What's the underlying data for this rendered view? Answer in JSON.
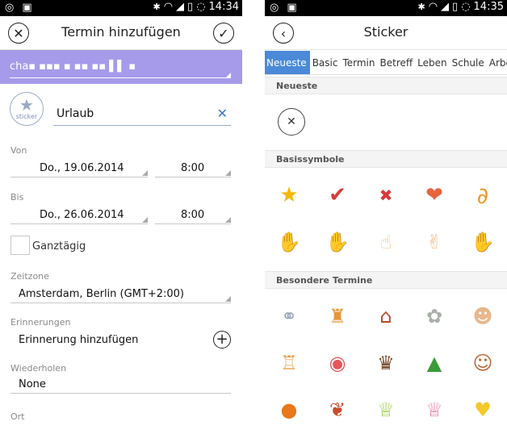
{
  "left": {
    "status_time": "14:34",
    "title": "Termin hinzufügen",
    "calendar_value": "cha▪ ▪▪▪ ▪ ▪▪ ▪▪ ▌▌ ▪",
    "title_value": "Urlaub",
    "sticker_label": "sticker",
    "from_label": "Von",
    "from_date": "Do., 19.06.2014",
    "from_time": "8:00",
    "to_label": "Bis",
    "to_date": "Do., 26.06.2014",
    "to_time": "8:00",
    "all_day_label": "Ganztägig",
    "timezone_label": "Zeitzone",
    "timezone_value": "Amsterdam, Berlin (GMT+2:00)",
    "reminders_label": "Erinnerungen",
    "add_reminder_label": "Erinnerung hinzufügen",
    "repeat_label": "Wiederholen",
    "repeat_value": "None",
    "location_label": "Ort",
    "accent_color": "#a59bea"
  },
  "right": {
    "status_time": "14:35",
    "title": "Sticker",
    "tabs": [
      "Neueste",
      "Basic",
      "Termin",
      "Betreff",
      "Leben",
      "Schule",
      "Arbeit"
    ],
    "active_tab": "Neueste",
    "section_recent": "Neueste",
    "section_basic": "Basissymbole",
    "section_special": "Besondere Termine",
    "basic_icons": [
      "star",
      "check",
      "cross",
      "heart",
      "paperclip",
      "ok-hand",
      "stop-hand",
      "finger-sparkle",
      "victory-hand",
      "thumb-down"
    ],
    "special_icons": [
      "rings",
      "birthday-cake",
      "house",
      "flower",
      "baby",
      "cake-slice",
      "candy",
      "cupcake",
      "christmas-tree",
      "couple",
      "pumpkin",
      "bouquet",
      "muffin",
      "cupcake-2",
      "chick"
    ],
    "accent_color": "#4a8ad9"
  }
}
